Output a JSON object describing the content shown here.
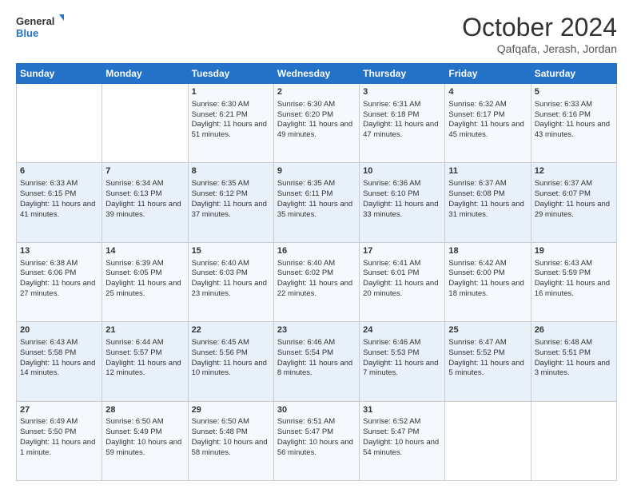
{
  "logo": {
    "line1": "General",
    "line2": "Blue"
  },
  "title": "October 2024",
  "location": "Qafqafa, Jerash, Jordan",
  "weekdays": [
    "Sunday",
    "Monday",
    "Tuesday",
    "Wednesday",
    "Thursday",
    "Friday",
    "Saturday"
  ],
  "weeks": [
    [
      {
        "day": "",
        "info": ""
      },
      {
        "day": "",
        "info": ""
      },
      {
        "day": "1",
        "info": "Sunrise: 6:30 AM\nSunset: 6:21 PM\nDaylight: 11 hours and 51 minutes."
      },
      {
        "day": "2",
        "info": "Sunrise: 6:30 AM\nSunset: 6:20 PM\nDaylight: 11 hours and 49 minutes."
      },
      {
        "day": "3",
        "info": "Sunrise: 6:31 AM\nSunset: 6:18 PM\nDaylight: 11 hours and 47 minutes."
      },
      {
        "day": "4",
        "info": "Sunrise: 6:32 AM\nSunset: 6:17 PM\nDaylight: 11 hours and 45 minutes."
      },
      {
        "day": "5",
        "info": "Sunrise: 6:33 AM\nSunset: 6:16 PM\nDaylight: 11 hours and 43 minutes."
      }
    ],
    [
      {
        "day": "6",
        "info": "Sunrise: 6:33 AM\nSunset: 6:15 PM\nDaylight: 11 hours and 41 minutes."
      },
      {
        "day": "7",
        "info": "Sunrise: 6:34 AM\nSunset: 6:13 PM\nDaylight: 11 hours and 39 minutes."
      },
      {
        "day": "8",
        "info": "Sunrise: 6:35 AM\nSunset: 6:12 PM\nDaylight: 11 hours and 37 minutes."
      },
      {
        "day": "9",
        "info": "Sunrise: 6:35 AM\nSunset: 6:11 PM\nDaylight: 11 hours and 35 minutes."
      },
      {
        "day": "10",
        "info": "Sunrise: 6:36 AM\nSunset: 6:10 PM\nDaylight: 11 hours and 33 minutes."
      },
      {
        "day": "11",
        "info": "Sunrise: 6:37 AM\nSunset: 6:08 PM\nDaylight: 11 hours and 31 minutes."
      },
      {
        "day": "12",
        "info": "Sunrise: 6:37 AM\nSunset: 6:07 PM\nDaylight: 11 hours and 29 minutes."
      }
    ],
    [
      {
        "day": "13",
        "info": "Sunrise: 6:38 AM\nSunset: 6:06 PM\nDaylight: 11 hours and 27 minutes."
      },
      {
        "day": "14",
        "info": "Sunrise: 6:39 AM\nSunset: 6:05 PM\nDaylight: 11 hours and 25 minutes."
      },
      {
        "day": "15",
        "info": "Sunrise: 6:40 AM\nSunset: 6:03 PM\nDaylight: 11 hours and 23 minutes."
      },
      {
        "day": "16",
        "info": "Sunrise: 6:40 AM\nSunset: 6:02 PM\nDaylight: 11 hours and 22 minutes."
      },
      {
        "day": "17",
        "info": "Sunrise: 6:41 AM\nSunset: 6:01 PM\nDaylight: 11 hours and 20 minutes."
      },
      {
        "day": "18",
        "info": "Sunrise: 6:42 AM\nSunset: 6:00 PM\nDaylight: 11 hours and 18 minutes."
      },
      {
        "day": "19",
        "info": "Sunrise: 6:43 AM\nSunset: 5:59 PM\nDaylight: 11 hours and 16 minutes."
      }
    ],
    [
      {
        "day": "20",
        "info": "Sunrise: 6:43 AM\nSunset: 5:58 PM\nDaylight: 11 hours and 14 minutes."
      },
      {
        "day": "21",
        "info": "Sunrise: 6:44 AM\nSunset: 5:57 PM\nDaylight: 11 hours and 12 minutes."
      },
      {
        "day": "22",
        "info": "Sunrise: 6:45 AM\nSunset: 5:56 PM\nDaylight: 11 hours and 10 minutes."
      },
      {
        "day": "23",
        "info": "Sunrise: 6:46 AM\nSunset: 5:54 PM\nDaylight: 11 hours and 8 minutes."
      },
      {
        "day": "24",
        "info": "Sunrise: 6:46 AM\nSunset: 5:53 PM\nDaylight: 11 hours and 7 minutes."
      },
      {
        "day": "25",
        "info": "Sunrise: 6:47 AM\nSunset: 5:52 PM\nDaylight: 11 hours and 5 minutes."
      },
      {
        "day": "26",
        "info": "Sunrise: 6:48 AM\nSunset: 5:51 PM\nDaylight: 11 hours and 3 minutes."
      }
    ],
    [
      {
        "day": "27",
        "info": "Sunrise: 6:49 AM\nSunset: 5:50 PM\nDaylight: 11 hours and 1 minute."
      },
      {
        "day": "28",
        "info": "Sunrise: 6:50 AM\nSunset: 5:49 PM\nDaylight: 10 hours and 59 minutes."
      },
      {
        "day": "29",
        "info": "Sunrise: 6:50 AM\nSunset: 5:48 PM\nDaylight: 10 hours and 58 minutes."
      },
      {
        "day": "30",
        "info": "Sunrise: 6:51 AM\nSunset: 5:47 PM\nDaylight: 10 hours and 56 minutes."
      },
      {
        "day": "31",
        "info": "Sunrise: 6:52 AM\nSunset: 5:47 PM\nDaylight: 10 hours and 54 minutes."
      },
      {
        "day": "",
        "info": ""
      },
      {
        "day": "",
        "info": ""
      }
    ]
  ]
}
